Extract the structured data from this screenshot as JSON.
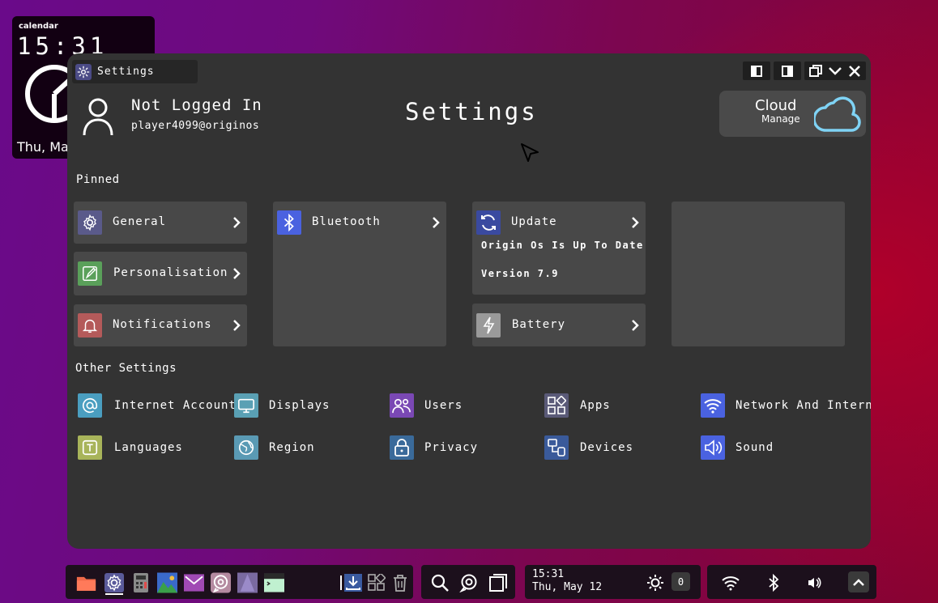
{
  "calendar_widget": {
    "title": "calendar",
    "time": "15:31",
    "date": "Thu, Ma"
  },
  "window": {
    "tab_label": "Settings",
    "page_title": "Settings"
  },
  "user": {
    "name": "Not Logged In",
    "email": "player4099@originos"
  },
  "cloud": {
    "title": "Cloud",
    "subtitle": "Manage"
  },
  "sections": {
    "pinned": "Pinned",
    "other": "Other Settings"
  },
  "pinned": {
    "general": "General",
    "personalisation": "Personalisation",
    "notifications": "Notifications",
    "bluetooth": "Bluetooth",
    "update": "Update",
    "update_status": "Origin Os Is Up To Date",
    "update_version": "Version 7.9",
    "battery": "Battery"
  },
  "other_settings": [
    {
      "label": "Internet Accounts",
      "icon": "at-icon",
      "color": "#4a9ec0"
    },
    {
      "label": "Displays",
      "icon": "monitor-icon",
      "color": "#5aa0b4"
    },
    {
      "label": "Users",
      "icon": "users-icon",
      "color": "#7a48b4"
    },
    {
      "label": "Apps",
      "icon": "apps-icon",
      "color": "#5a5a78"
    },
    {
      "label": "Network And Internet",
      "icon": "wifi-icon",
      "color": "#4a62e0"
    },
    {
      "label": "Languages",
      "icon": "language-icon",
      "color": "#a8b45a"
    },
    {
      "label": "Region",
      "icon": "globe-icon",
      "color": "#5a9ab4"
    },
    {
      "label": "Privacy",
      "icon": "lock-icon",
      "color": "#3a6a9a"
    },
    {
      "label": "Devices",
      "icon": "devices-icon",
      "color": "#3a5a9a"
    },
    {
      "label": "Sound",
      "icon": "speaker-icon",
      "color": "#4a62e0"
    }
  ],
  "taskbar": {
    "time": "15:31",
    "date": "Thu, May 12",
    "notification_count": "0"
  }
}
